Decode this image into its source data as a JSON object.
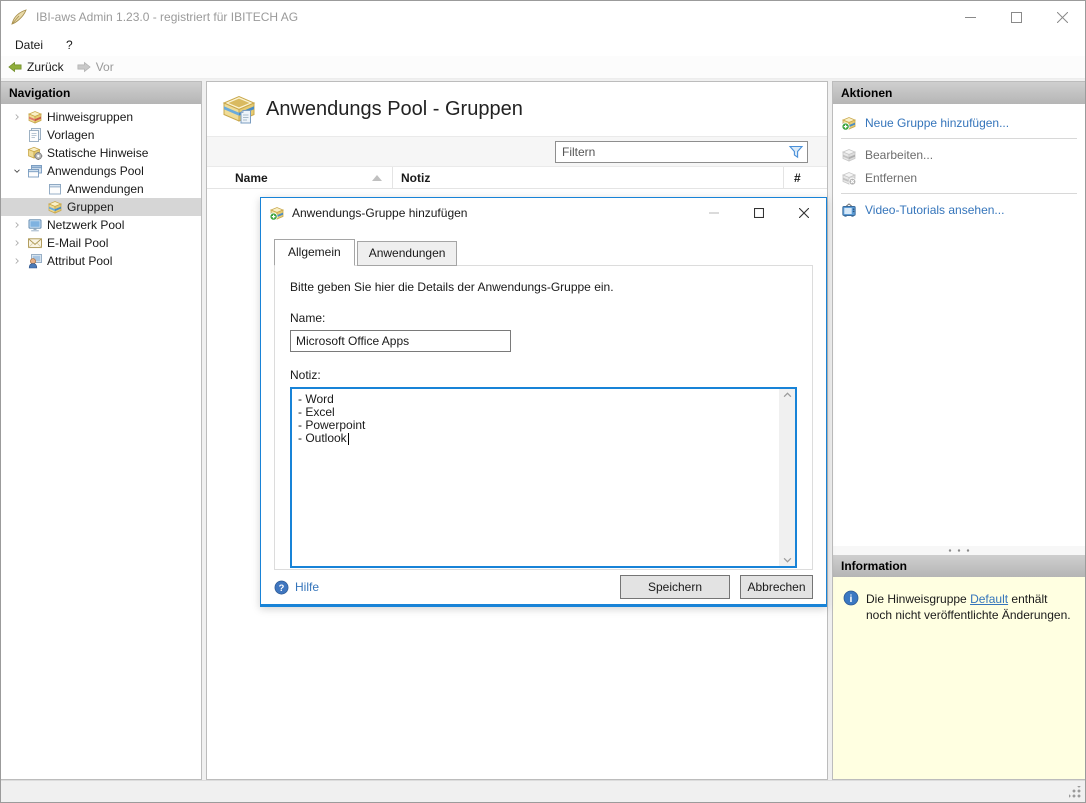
{
  "window": {
    "title": "IBI-aws Admin 1.23.0 - registriert für IBITECH AG"
  },
  "menubar": {
    "items": [
      {
        "label": "Datei"
      },
      {
        "label": "?"
      }
    ]
  },
  "toolbar": {
    "back_label": "Zurück",
    "forward_label": "Vor"
  },
  "navigation": {
    "header": "Navigation",
    "items": [
      {
        "label": "Hinweisgruppen",
        "icon": "notice-groups-icon",
        "state": "collapsed"
      },
      {
        "label": "Vorlagen",
        "icon": "templates-icon"
      },
      {
        "label": "Statische Hinweise",
        "icon": "static-notices-icon"
      },
      {
        "label": "Anwendungs Pool",
        "icon": "application-pool-icon",
        "state": "expanded"
      },
      {
        "label": "Anwendungen",
        "icon": "applications-icon",
        "indent": 1
      },
      {
        "label": "Gruppen",
        "icon": "groups-icon",
        "indent": 1,
        "selected": true
      },
      {
        "label": "Netzwerk Pool",
        "icon": "network-pool-icon",
        "state": "collapsed"
      },
      {
        "label": "E-Mail Pool",
        "icon": "email-pool-icon",
        "state": "collapsed"
      },
      {
        "label": "Attribut Pool",
        "icon": "attribute-pool-icon",
        "state": "collapsed"
      }
    ]
  },
  "content": {
    "title": "Anwendungs Pool - Gruppen",
    "filter_placeholder": "Filtern",
    "table": {
      "columns": [
        "Name",
        "Notiz",
        "#"
      ],
      "rows": []
    }
  },
  "dialog": {
    "title": "Anwendungs-Gruppe hinzufügen",
    "tabs": [
      {
        "label": "Allgemein",
        "active": true
      },
      {
        "label": "Anwendungen",
        "active": false
      }
    ],
    "description": "Bitte geben Sie hier die Details der Anwendungs-Gruppe ein.",
    "name_label": "Name:",
    "name_value": "Microsoft Office Apps",
    "note_label": "Notiz:",
    "note_value": "- Word\n- Excel\n- Powerpoint\n- Outlook",
    "help_label": "Hilfe",
    "save_label": "Speichern",
    "cancel_label": "Abbrechen"
  },
  "actions": {
    "header": "Aktionen",
    "items": [
      {
        "label": "Neue Gruppe hinzufügen...",
        "enabled": true
      },
      {
        "label": "Bearbeiten...",
        "enabled": false
      },
      {
        "label": "Entfernen",
        "enabled": false
      },
      {
        "label": "Video-Tutorials ansehen...",
        "enabled": true
      }
    ]
  },
  "information": {
    "header": "Information",
    "text_before": "Die Hinweisgruppe ",
    "link_label": "Default",
    "text_after": " enthält noch nicht veröffentlichte Änderungen."
  },
  "colors": {
    "dialog_border": "#1883d7",
    "link_blue": "#3575bb",
    "disabled_gray": "#6d6d6d",
    "info_background": "#ffffe1",
    "selection_gray": "#d6d6d6",
    "back_arrow_green": "#8fae3c",
    "panel_header_gray": "#bfbfbf",
    "box_icon_yellow": "#f0dc96"
  }
}
